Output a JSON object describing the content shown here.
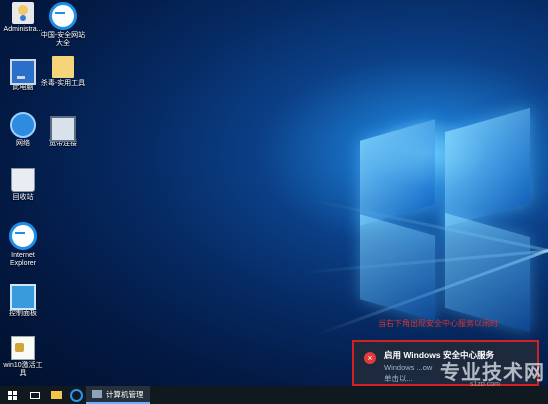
{
  "desktop": {
    "icons": [
      {
        "label": "Administra..."
      },
      {
        "label": "中国-安全网站大全"
      },
      {
        "label": "此电脑"
      },
      {
        "label": "杀毒-实用工具"
      },
      {
        "label": "网络"
      },
      {
        "label": "宽带连接"
      },
      {
        "label": "回收站"
      },
      {
        "label": "Internet Explorer"
      },
      {
        "label": "控制面板"
      },
      {
        "label": "win10激活工具"
      }
    ]
  },
  "annotation": "当右下角出现安全中心服务以闭时",
  "notification": {
    "title": "启用 Windows 安全中心服务",
    "line1": "Windows ...ow",
    "line2": "单击以..."
  },
  "watermark": {
    "text": "专业技术网",
    "sub": "s1zp.com"
  },
  "taskbar": {
    "running_app_label": "计算机管理"
  }
}
